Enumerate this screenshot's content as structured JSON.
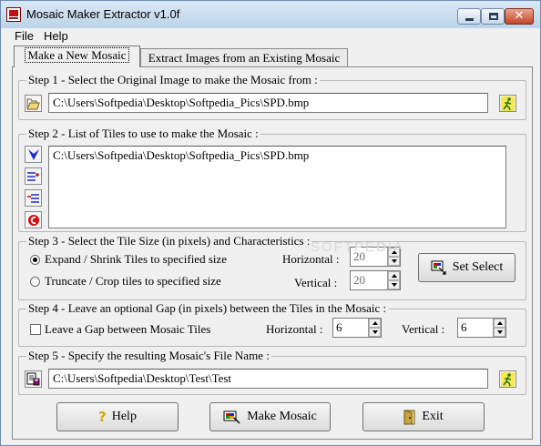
{
  "window": {
    "title": "Mosaic Maker Extractor v1.0f"
  },
  "menu": {
    "file": "File",
    "help": "Help"
  },
  "tabs": {
    "active": "Make a New Mosaic",
    "inactive": "Extract Images from an Existing  Mosaic"
  },
  "step1": {
    "title": "Step 1 - Select the Original Image to make the Mosaic from :",
    "path": "C:\\Users\\Softpedia\\Desktop\\Softpedia_Pics\\SPD.bmp"
  },
  "step2": {
    "title": "Step 2 - List of Tiles to use to make the Mosaic :",
    "tiles": [
      "C:\\Users\\Softpedia\\Desktop\\Softpedia_Pics\\SPD.bmp"
    ]
  },
  "step3": {
    "title": "Step 3 - Select the Tile Size (in pixels) and Characteristics :",
    "option_expand": "Expand / Shrink Tiles to specified size",
    "option_truncate": "Truncate / Crop tiles to specified size",
    "horizontal_label": "Horizontal :",
    "vertical_label": "Vertical :",
    "horizontal_value": "20",
    "vertical_value": "20",
    "set_select": "Set Select"
  },
  "step4": {
    "title": "Step 4 - Leave an optional Gap (in pixels) between the Tiles in the Mosaic :",
    "checkbox_label": "Leave a Gap between Mosaic Tiles",
    "horizontal_label": "Horizontal :",
    "vertical_label": "Vertical :",
    "horizontal_value": "6",
    "vertical_value": "6"
  },
  "step5": {
    "title": "Step 5 - Specify the resulting Mosaic's File Name :",
    "path": "C:\\Users\\Softpedia\\Desktop\\Test\\Test"
  },
  "buttons": {
    "help": "Help",
    "make": "Make Mosaic",
    "exit": "Exit"
  },
  "watermark": "SOFTPEDIA"
}
